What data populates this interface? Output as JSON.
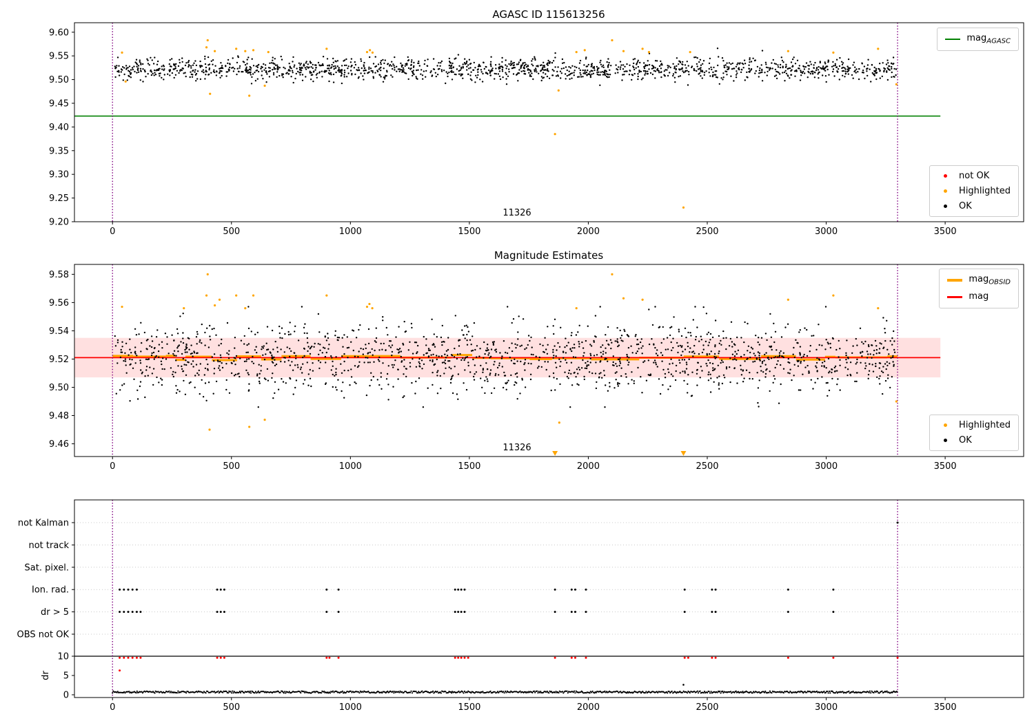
{
  "colors": {
    "ok": "#000000",
    "highlighted": "#FFA500",
    "not_ok": "#FF0000",
    "mag_agasc_line": "#008000",
    "mag_line": "#FF0000",
    "obsid_line": "#FFA500",
    "band": "rgba(255,0,0,0.12)",
    "vline": "#800080",
    "axis": "#000000",
    "grid": "#c8c8c8"
  },
  "chart_data": [
    {
      "type": "scatter",
      "title": "AGASC ID 115613256",
      "xlim": [
        -160,
        3830
      ],
      "ylim": [
        9.2,
        9.62
      ],
      "xticks": [
        0,
        500,
        1000,
        1500,
        2000,
        2500,
        3000,
        3500
      ],
      "yticks": [
        9.2,
        9.25,
        9.3,
        9.35,
        9.4,
        9.45,
        9.5,
        9.55,
        9.6
      ],
      "vlines": [
        0,
        3300
      ],
      "mag_agasc": 9.423,
      "agasc_line_span": [
        -160,
        3480
      ],
      "obsid_annotation": {
        "text": "11326",
        "x": 1700,
        "y": 9.215
      },
      "legend_line": {
        "main": "mag",
        "sub": "AGASC"
      },
      "legend_points": [
        {
          "label": "not OK"
        },
        {
          "label": "Highlighted"
        },
        {
          "label": "OK"
        }
      ],
      "ok_cloud": {
        "n": 1600,
        "x_range": [
          5,
          3295
        ],
        "mean": 9.522,
        "sd": 0.0115,
        "clip": [
          9.488,
          9.566
        ],
        "seed": 42
      },
      "highlighted_points": [
        [
          40,
          9.557
        ],
        [
          55,
          9.496
        ],
        [
          395,
          9.568
        ],
        [
          400,
          9.583
        ],
        [
          410,
          9.47
        ],
        [
          430,
          9.56
        ],
        [
          520,
          9.565
        ],
        [
          558,
          9.56
        ],
        [
          575,
          9.466
        ],
        [
          592,
          9.562
        ],
        [
          640,
          9.487
        ],
        [
          655,
          9.558
        ],
        [
          900,
          9.565
        ],
        [
          1070,
          9.558
        ],
        [
          1082,
          9.562
        ],
        [
          1093,
          9.557
        ],
        [
          1860,
          9.385
        ],
        [
          1875,
          9.477
        ],
        [
          1950,
          9.558
        ],
        [
          1985,
          9.562
        ],
        [
          2100,
          9.583
        ],
        [
          2148,
          9.56
        ],
        [
          2228,
          9.565
        ],
        [
          2255,
          9.558
        ],
        [
          2400,
          9.23
        ],
        [
          2428,
          9.558
        ],
        [
          2840,
          9.56
        ],
        [
          3030,
          9.557
        ],
        [
          3218,
          9.565
        ],
        [
          3295,
          9.49
        ]
      ]
    },
    {
      "type": "scatter",
      "title": "Magnitude Estimates",
      "xlim": [
        -160,
        3830
      ],
      "ylim": [
        9.451,
        9.587
      ],
      "xticks": [
        0,
        500,
        1000,
        1500,
        2000,
        2500,
        3000,
        3500
      ],
      "yticks": [
        9.46,
        9.48,
        9.5,
        9.52,
        9.54,
        9.56,
        9.58
      ],
      "vlines": [
        0,
        3300
      ],
      "mag": 9.521,
      "band": [
        9.507,
        9.535
      ],
      "line_span": [
        -160,
        3480
      ],
      "obsid_annotation": {
        "text": "11326",
        "x": 1700,
        "y": 9.456
      },
      "legend_lines": [
        {
          "main": "mag",
          "sub": "OBSID"
        },
        {
          "main": "mag",
          "sub": ""
        }
      ],
      "legend_points": [
        {
          "label": "Highlighted"
        },
        {
          "label": "OK"
        }
      ],
      "ok_cloud": {
        "n": 1600,
        "x_range": [
          5,
          3295
        ],
        "mean": 9.521,
        "sd": 0.0125,
        "clip": [
          9.486,
          9.557
        ],
        "seed": 101
      },
      "obsid_segments": {
        "seed": 99,
        "jitter": 0.004
      },
      "highlighted_points": [
        [
          40,
          9.557
        ],
        [
          300,
          9.556
        ],
        [
          395,
          9.565
        ],
        [
          400,
          9.58
        ],
        [
          408,
          9.47
        ],
        [
          430,
          9.558
        ],
        [
          450,
          9.562
        ],
        [
          520,
          9.565
        ],
        [
          558,
          9.556
        ],
        [
          575,
          9.472
        ],
        [
          592,
          9.565
        ],
        [
          640,
          9.477
        ],
        [
          900,
          9.565
        ],
        [
          1070,
          9.557
        ],
        [
          1080,
          9.559
        ],
        [
          1092,
          9.556
        ],
        [
          1878,
          9.475
        ],
        [
          1950,
          9.556
        ],
        [
          2100,
          9.58
        ],
        [
          2148,
          9.563
        ],
        [
          2228,
          9.562
        ],
        [
          2840,
          9.562
        ],
        [
          3030,
          9.565
        ],
        [
          3218,
          9.556
        ],
        [
          3295,
          9.49
        ]
      ],
      "triangle_down_x": [
        1860,
        2400
      ]
    },
    {
      "type": "flags",
      "categories": [
        "not Kalman",
        "not track",
        "Sat. pixel.",
        "Ion. rad.",
        "dr > 5",
        "OBS not OK"
      ],
      "dr_label": "dr",
      "dr_ticks": [
        0,
        5,
        10
      ],
      "xticks": [
        0,
        500,
        1000,
        1500,
        2000,
        2500,
        3000,
        3500
      ],
      "vlines": [
        0,
        3300
      ],
      "ion_rad_x": [
        30,
        48,
        66,
        84,
        102,
        440,
        455,
        470,
        900,
        950,
        1440,
        1453,
        1466,
        1480,
        1860,
        1930,
        1945,
        1990,
        2405,
        2520,
        2535,
        2840,
        3030
      ],
      "dr5_x": [
        30,
        48,
        66,
        84,
        102,
        118,
        440,
        455,
        470,
        900,
        950,
        1440,
        1453,
        1466,
        1480,
        1860,
        1930,
        1945,
        1990,
        2405,
        2520,
        2535,
        2840,
        3030
      ],
      "not_kalman_x": [
        3300
      ],
      "red_dr10_x": [
        30,
        48,
        66,
        84,
        102,
        118,
        440,
        455,
        470,
        900,
        912,
        950,
        1440,
        1453,
        1466,
        1480,
        1495,
        1860,
        1930,
        1945,
        1990,
        2405,
        2420,
        2520,
        2535,
        2840,
        3030,
        3300
      ],
      "red_extra": [
        [
          30,
          6.3
        ]
      ],
      "black_extra": [
        [
          2400,
          2.6
        ]
      ],
      "dr_baseline": {
        "x_range": [
          0,
          3300
        ],
        "base": 0.45,
        "noise": 0.5,
        "seed": 7
      }
    }
  ]
}
